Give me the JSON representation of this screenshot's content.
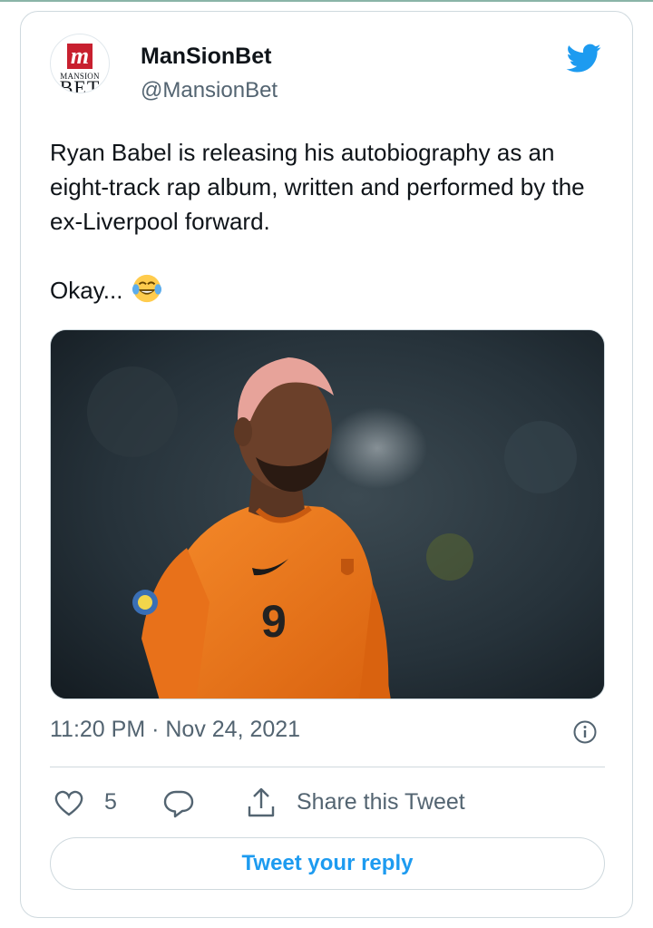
{
  "account": {
    "display_name": "ManSionBet",
    "handle": "@MansionBet",
    "avatar_mark": "m",
    "avatar_word_1": "MANSION",
    "avatar_word_2": "BET"
  },
  "tweet": {
    "text": "Ryan Babel is releasing his autobiography as an eight-track rap album, written and performed by the ex-Liverpool forward.\n\nOkay...",
    "emoji": "face-with-tears-of-joy",
    "timestamp": "11:20 PM · Nov 24, 2021"
  },
  "actions": {
    "like_count": "5",
    "share_label": "Share this Tweet",
    "reply_label": "Tweet your reply"
  },
  "media": {
    "shirt_number": "9"
  },
  "icons": [
    "twitter-bird-icon",
    "info-icon",
    "heart-icon",
    "reply-bubble-icon",
    "share-icon"
  ],
  "colors": {
    "accent": "#1d9bf0",
    "border": "#cfd9de",
    "secondary_text": "#536471",
    "brand_red": "#c8202f",
    "jersey_orange": "#f07a1a"
  }
}
